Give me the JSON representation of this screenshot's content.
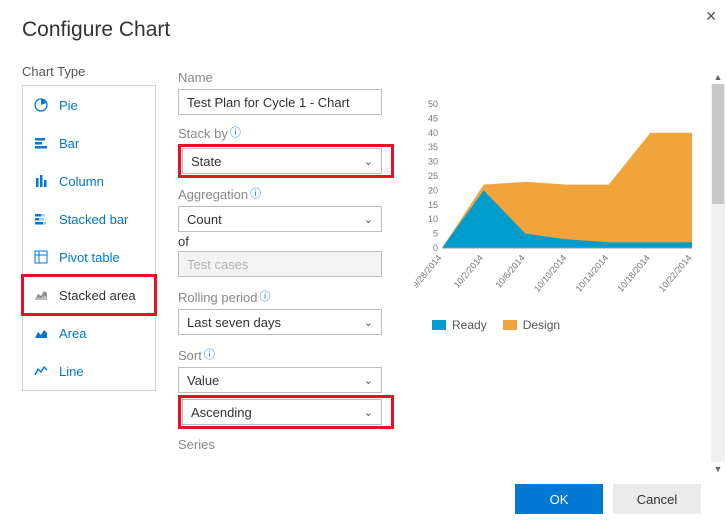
{
  "dialog": {
    "title": "Configure Chart",
    "close_icon": "✕"
  },
  "sidebar": {
    "label": "Chart Type",
    "items": [
      {
        "label": "Pie"
      },
      {
        "label": "Bar"
      },
      {
        "label": "Column"
      },
      {
        "label": "Stacked bar"
      },
      {
        "label": "Pivot table"
      },
      {
        "label": "Stacked area",
        "selected": true
      },
      {
        "label": "Area"
      },
      {
        "label": "Line"
      }
    ]
  },
  "form": {
    "name_label": "Name",
    "name_value": "Test Plan for Cycle 1 - Chart",
    "stack_by_label": "Stack by",
    "stack_by_value": "State",
    "aggregation_label": "Aggregation",
    "aggregation_value": "Count",
    "of_label": "of",
    "of_value": "Test cases",
    "rolling_label": "Rolling period",
    "rolling_value": "Last seven days",
    "sort_label": "Sort",
    "sort_field": "Value",
    "sort_dir": "Ascending",
    "series_label": "Series"
  },
  "footer": {
    "ok": "OK",
    "cancel": "Cancel"
  },
  "legend": {
    "ready": "Ready",
    "design": "Design"
  },
  "colors": {
    "ready": "#009ccc",
    "design": "#f2a43c",
    "primary": "#0078d4"
  },
  "chart_data": {
    "type": "area",
    "title": "",
    "xlabel": "",
    "ylabel": "",
    "ylim": [
      0,
      50
    ],
    "yticks": [
      50,
      45,
      40,
      35,
      30,
      25,
      20,
      15,
      10,
      5,
      0
    ],
    "categories": [
      "9/28/2014",
      "10/2/2014",
      "10/6/2014",
      "10/10/2014",
      "10/14/2014",
      "10/18/2014",
      "10/22/2014"
    ],
    "series": [
      {
        "name": "Ready",
        "color": "#009ccc",
        "values": [
          0,
          20,
          5,
          3,
          2,
          2,
          2
        ]
      },
      {
        "name": "Design",
        "color": "#f2a43c",
        "values": [
          0,
          2,
          18,
          19,
          20,
          38,
          38
        ]
      }
    ]
  }
}
